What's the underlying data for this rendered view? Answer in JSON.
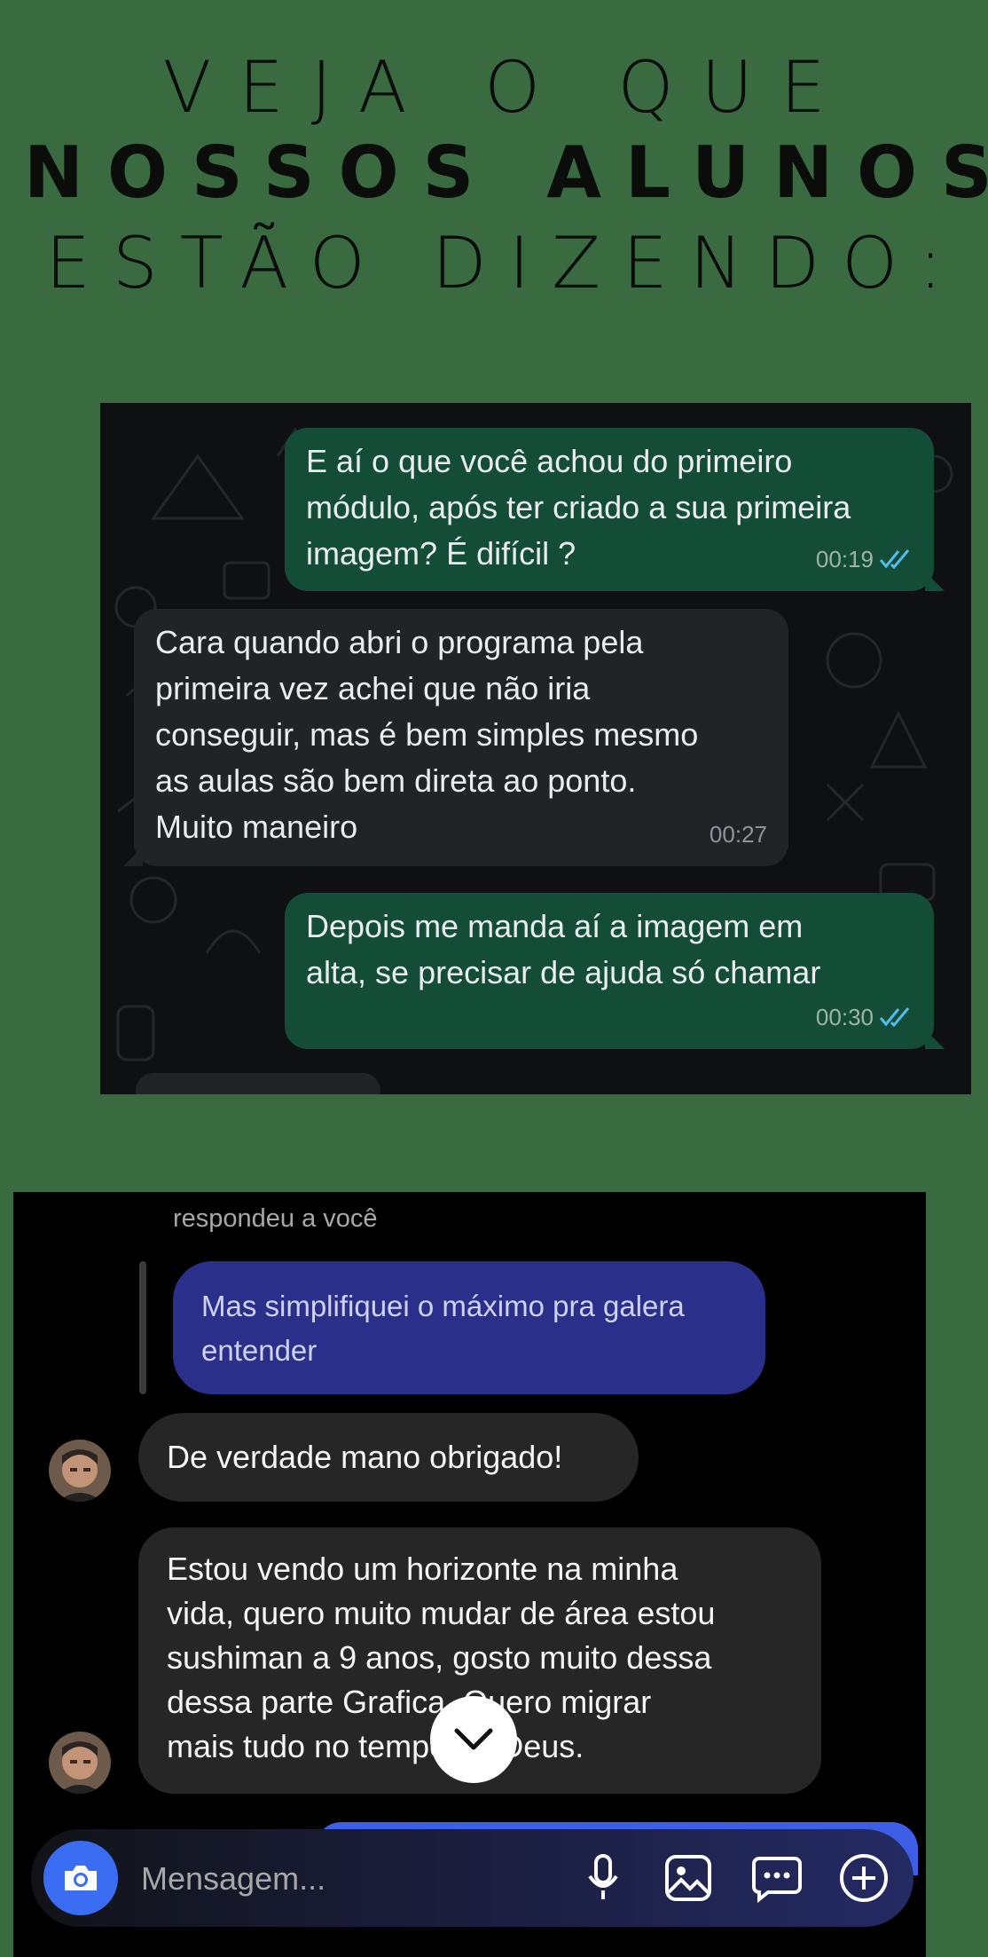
{
  "headline": {
    "line1": "VEJA O QUE",
    "line2": "NOSSOS ALUNOS",
    "line3": "ESTÃO DIZENDO:"
  },
  "whatsapp": {
    "messages": [
      {
        "direction": "outgoing",
        "text_lines": [
          "E aí o que você achou do primeiro",
          "módulo, após ter criado a sua primeira",
          "imagem? É difícil ?"
        ],
        "time": "00:19",
        "read": true
      },
      {
        "direction": "incoming",
        "text_lines": [
          "Cara quando abri o programa pela",
          "primeira vez achei que não iria",
          "conseguir, mas é bem simples mesmo",
          "as aulas são bem direta ao ponto.",
          "Muito maneiro"
        ],
        "time": "00:27"
      },
      {
        "direction": "outgoing",
        "text_lines": [
          "Depois me manda aí a imagem em",
          "alta, se precisar de ajuda só chamar"
        ],
        "time": "00:30",
        "read": true
      }
    ]
  },
  "instagram": {
    "reply_label": "respondeu a você",
    "replied_message": [
      "Mas simplifiquei o máximo pra galera",
      "entender"
    ],
    "messages": [
      {
        "text_lines": [
          "De verdade mano obrigado!"
        ]
      },
      {
        "text_lines": [
          "Estou vendo um horizonte na minha",
          "vida, quero muito mudar de área estou",
          "sushiman a 9 anos, gosto muito dessa",
          "dessa parte Grafica. Quero migrar",
          "mais tudo no tempo de Deus."
        ]
      }
    ],
    "composer": {
      "placeholder": "Mensagem..."
    },
    "icons": [
      "camera-icon",
      "microphone-icon",
      "gallery-icon",
      "sticker-icon",
      "plus-icon",
      "chevron-down-icon"
    ],
    "colors": {
      "camera_button": "#3b6df3",
      "reply_bubble": "#2a2f8a",
      "bubble": "#262626"
    }
  },
  "colors": {
    "page_background": "#396a40",
    "wa_outgoing": "#144d37",
    "wa_incoming": "#212427",
    "read_ticks": "#53bdeb"
  }
}
